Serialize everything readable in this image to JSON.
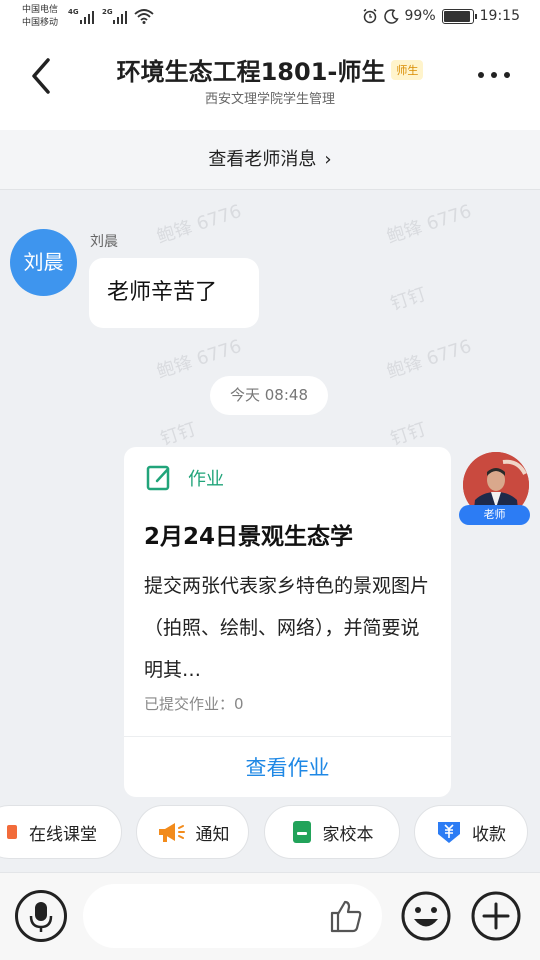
{
  "status_bar": {
    "carrier_1": "中国电信",
    "carrier_2": "中国移动",
    "net_1": "4G",
    "net_2": "2G",
    "battery": "99%",
    "time": "19:15"
  },
  "header": {
    "title": "环境生态工程1801-师生",
    "tag": "师生",
    "subtitle": "西安文理学院学生管理"
  },
  "teacher_messages_link": "查看老师消息",
  "watermark": {
    "name": "鲍锋 6776",
    "app": "钉钉"
  },
  "messages": [
    {
      "avatar_text": "刘晨",
      "sender": "刘晨",
      "text": "老师辛苦了"
    }
  ],
  "timestamp": "今天 08:48",
  "homework_card": {
    "label": "作业",
    "title": "2月24日景观生态学",
    "body": "提交两张代表家乡特色的景观图片（拍照、绘制、网络），并简要说明其…",
    "submitted": "已提交作业：0",
    "action": "查看作业",
    "role_badge": "老师"
  },
  "quick_actions": [
    {
      "label": "在线课堂",
      "icon": "live-class-icon",
      "color": "#f26b3a"
    },
    {
      "label": "通知",
      "icon": "megaphone-icon",
      "color": "#f28b1c"
    },
    {
      "label": "家校本",
      "icon": "notebook-icon",
      "color": "#22a35a"
    },
    {
      "label": "收款",
      "icon": "payment-icon",
      "color": "#2c7cf4"
    }
  ],
  "colors": {
    "accent": "#1f88e5",
    "avatar_blue": "#3e95ee",
    "homework_green": "#21a47a"
  }
}
